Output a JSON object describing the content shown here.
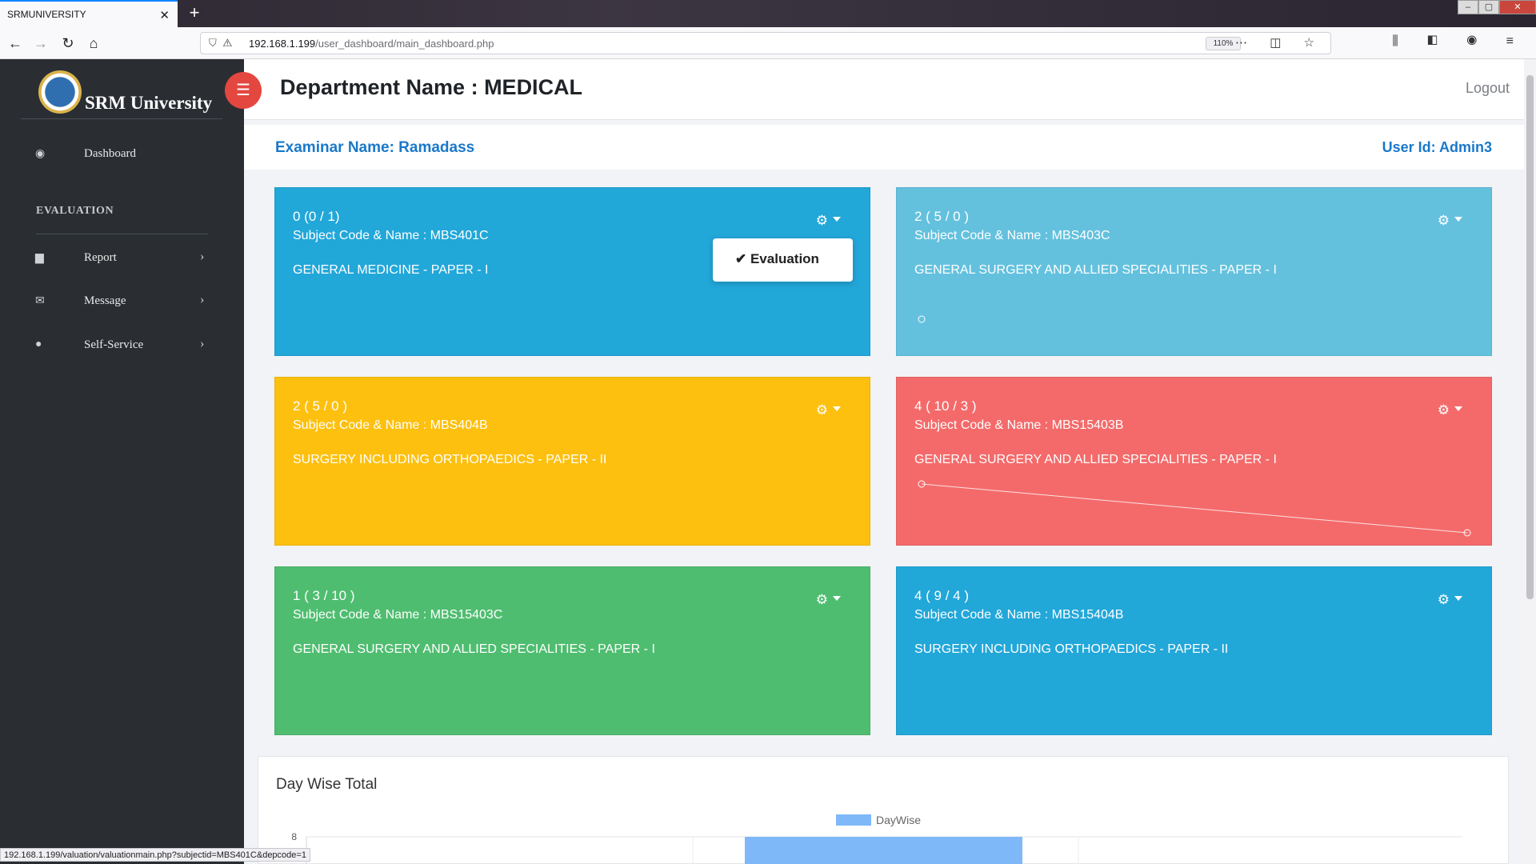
{
  "browser": {
    "tab_title": "SRMUNIVERSITY",
    "url_host": "192.168.1.199",
    "url_path": "/user_dashboard/main_dashboard.php",
    "zoom": "110%",
    "status_url": "192.168.1.199/valuation/valuationmain.php?subjectid=MBS401C&depcode=1"
  },
  "sidebar": {
    "brand": "SRM University",
    "dashboard_label": "Dashboard",
    "section_title": "EVALUATION",
    "items": [
      {
        "label": "Report",
        "icon": "file-icon"
      },
      {
        "label": "Message",
        "icon": "envelope-icon"
      },
      {
        "label": "Self-Service",
        "icon": "user-icon"
      }
    ]
  },
  "header": {
    "department": "Department Name : MEDICAL",
    "logout": "Logout",
    "examiner": "Examinar Name: Ramadass",
    "user_id": "User Id: Admin3"
  },
  "cards": [
    {
      "count": "0 (0 / 1)",
      "code": "Subject Code & Name : MBS401C",
      "name": "GENERAL MEDICINE - PAPER - I",
      "color": "#22a7d9"
    },
    {
      "count": "2 ( 5 / 0 )",
      "code": "Subject Code & Name : MBS403C",
      "name": "GENERAL SURGERY AND ALLIED SPECIALITIES - PAPER - I",
      "color": "#63c1de"
    },
    {
      "count": "2 ( 5 / 0 )",
      "code": "Subject Code & Name : MBS404B",
      "name": "SURGERY INCLUDING ORTHOPAEDICS - PAPER - II",
      "color": "#fdc00f"
    },
    {
      "count": "4 ( 10 / 3 )",
      "code": "Subject Code & Name : MBS15403B",
      "name": "GENERAL SURGERY AND ALLIED SPECIALITIES - PAPER - I",
      "color": "#f46a6a"
    },
    {
      "count": "1 ( 3 / 10 )",
      "code": "Subject Code & Name : MBS15403C",
      "name": "GENERAL SURGERY AND ALLIED SPECIALITIES - PAPER - I",
      "color": "#4fbd70"
    },
    {
      "count": "4 ( 9 / 4 )",
      "code": "Subject Code & Name : MBS15404B",
      "name": "SURGERY INCLUDING ORTHOPAEDICS - PAPER - II",
      "color": "#22a7d9"
    }
  ],
  "dropdown": {
    "label": "Evaluation"
  },
  "chart_data": {
    "type": "bar",
    "title": "Day Wise Total",
    "legend": "top-center",
    "series": [
      {
        "name": "DayWise",
        "color": "#7fb8f8",
        "values": [
          8
        ]
      }
    ],
    "y_ticks": [
      "8"
    ]
  }
}
